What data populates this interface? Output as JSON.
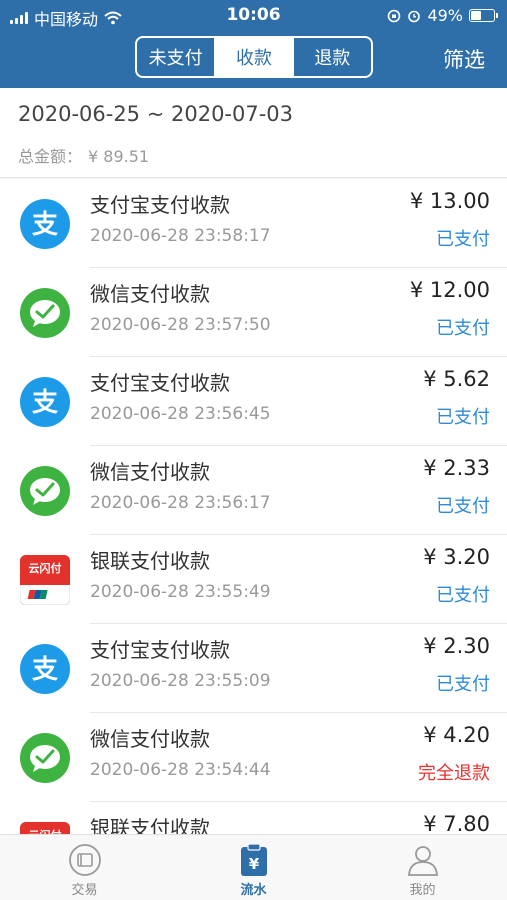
{
  "status_bar": {
    "carrier": "中国移动",
    "time": "10:06",
    "battery": "49%",
    "battery_level": 0.49
  },
  "header": {
    "tabs": [
      {
        "label": "未支付",
        "active": false
      },
      {
        "label": "收款",
        "active": true
      },
      {
        "label": "退款",
        "active": false
      }
    ],
    "filter_label": "筛选"
  },
  "summary": {
    "date_range": "2020-06-25 ~ 2020-07-03",
    "total_label": "总金额：",
    "total_value": "¥ 89.51"
  },
  "transactions": [
    {
      "icon": "alipay-icon",
      "title": "支付宝支付收款",
      "time": "2020-06-28 23:58:17",
      "amount": "¥ 13.00",
      "status": "已支付",
      "status_type": "paid"
    },
    {
      "icon": "wechat-pay-icon",
      "title": "微信支付收款",
      "time": "2020-06-28 23:57:50",
      "amount": "¥ 12.00",
      "status": "已支付",
      "status_type": "paid"
    },
    {
      "icon": "alipay-icon",
      "title": "支付宝支付收款",
      "time": "2020-06-28 23:56:45",
      "amount": "¥ 5.62",
      "status": "已支付",
      "status_type": "paid"
    },
    {
      "icon": "wechat-pay-icon",
      "title": "微信支付收款",
      "time": "2020-06-28 23:56:17",
      "amount": "¥ 2.33",
      "status": "已支付",
      "status_type": "paid"
    },
    {
      "icon": "unionpay-icon",
      "title": "银联支付收款",
      "time": "2020-06-28 23:55:49",
      "amount": "¥ 3.20",
      "status": "已支付",
      "status_type": "paid"
    },
    {
      "icon": "alipay-icon",
      "title": "支付宝支付收款",
      "time": "2020-06-28 23:55:09",
      "amount": "¥ 2.30",
      "status": "已支付",
      "status_type": "paid"
    },
    {
      "icon": "wechat-pay-icon",
      "title": "微信支付收款",
      "time": "2020-06-28 23:54:44",
      "amount": "¥ 4.20",
      "status": "完全退款",
      "status_type": "refund"
    },
    {
      "icon": "unionpay-icon",
      "title": "银联支付收款",
      "time": "",
      "amount": "¥ 7.80",
      "status": "",
      "status_type": "paid"
    }
  ],
  "tabbar": [
    {
      "label": "交易",
      "icon": "trade-icon",
      "active": false
    },
    {
      "label": "流水",
      "icon": "ledger-icon",
      "active": true
    },
    {
      "label": "我的",
      "icon": "profile-icon",
      "active": false
    }
  ],
  "colors": {
    "primary": "#2f6fa9",
    "paid": "#2f8ad8",
    "refund": "#e8332e",
    "alipay": "#1e9be8",
    "wechat": "#3fb341",
    "unionpay": "#e3322b"
  }
}
